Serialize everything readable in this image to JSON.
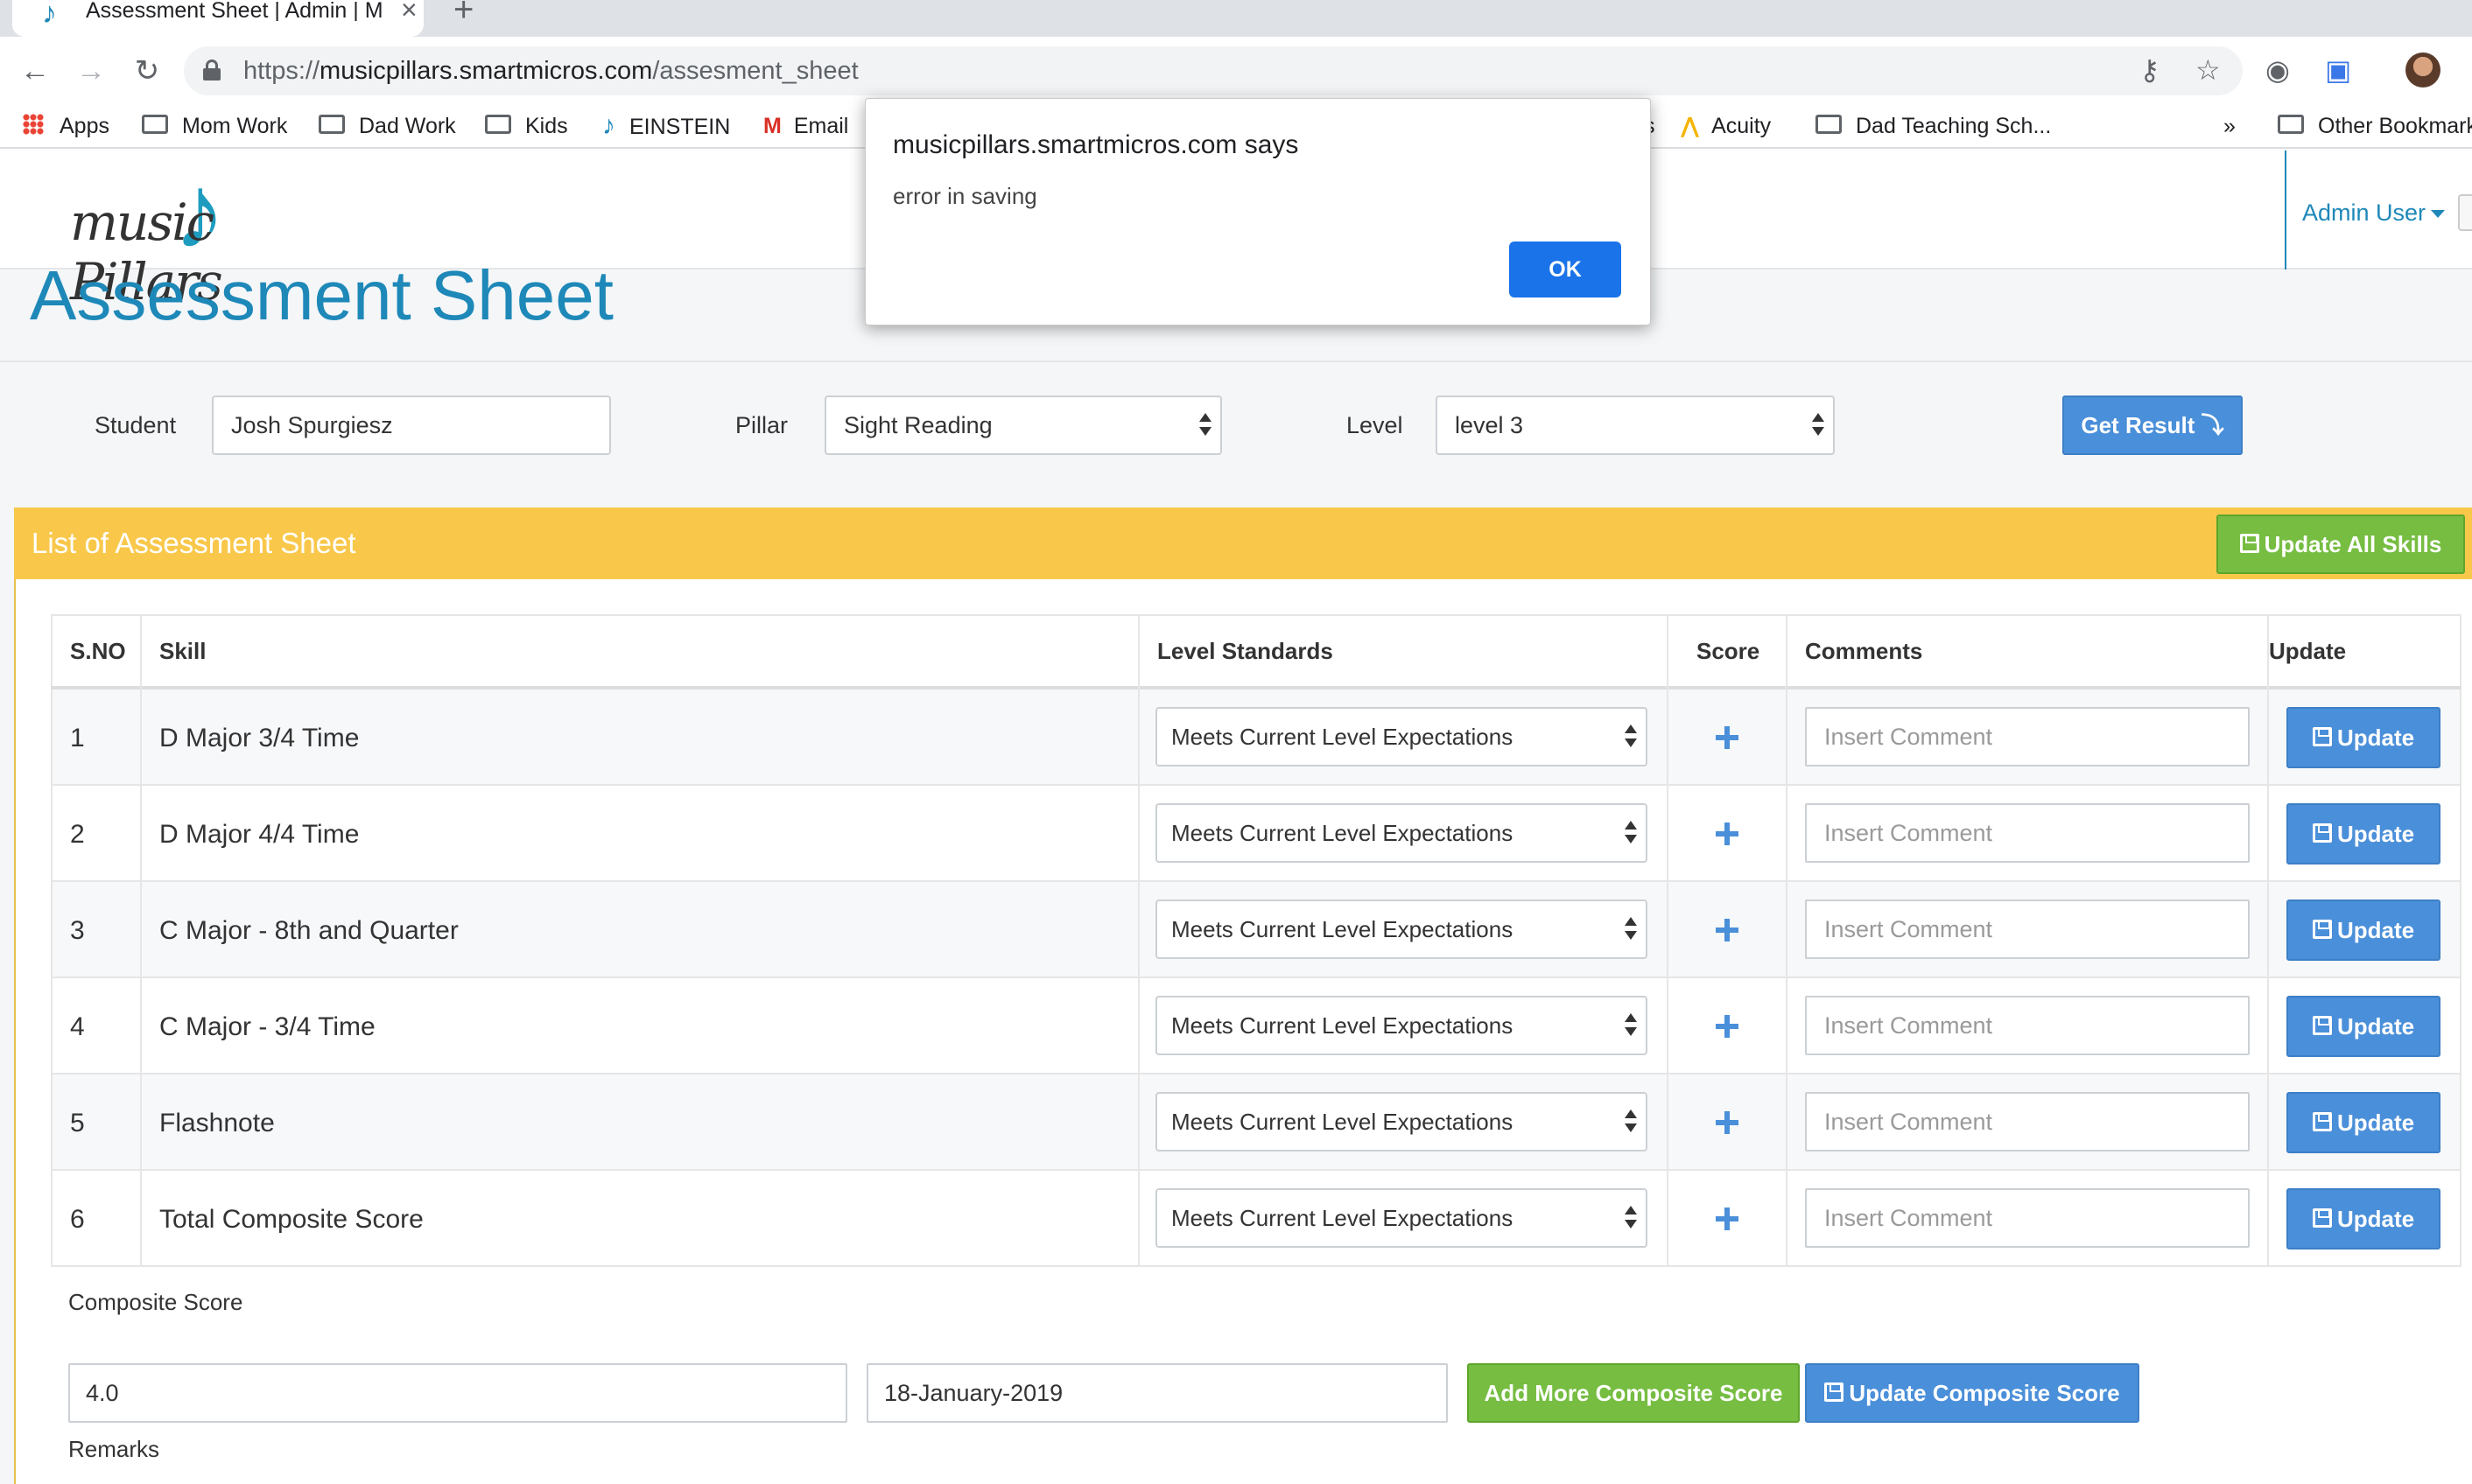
{
  "browser": {
    "tab_title": "Assessment Sheet | Admin | Mu",
    "tab_close": "×",
    "new_tab": "+",
    "url_scheme": "https://",
    "url_host": "musicpillars.smartmicros.com",
    "url_path": "/assesment_sheet",
    "bookmarks": [
      {
        "label": "Apps"
      },
      {
        "label": "Mom Work"
      },
      {
        "label": "Dad Work"
      },
      {
        "label": "Kids"
      },
      {
        "label": "EINSTEIN"
      },
      {
        "label": "Email"
      },
      {
        "label": "s"
      },
      {
        "label": "Acuity"
      },
      {
        "label": "Dad Teaching Sch..."
      },
      {
        "label": "»"
      },
      {
        "label": "Other Bookmarks"
      }
    ]
  },
  "header": {
    "logo_text": "music Pillars",
    "admin_user": "Admin User"
  },
  "page": {
    "title": "Assessment Sheet"
  },
  "filters": {
    "student_label": "Student",
    "student_value": "Josh Spurgiesz",
    "pillar_label": "Pillar",
    "pillar_value": "Sight Reading",
    "level_label": "Level",
    "level_value": "level 3",
    "get_result": "Get Result ⤵"
  },
  "panel": {
    "title": "List of Assessment Sheet",
    "update_all": "Update All Skills"
  },
  "table": {
    "headers": {
      "sno": "S.NO",
      "skill": "Skill",
      "level_standards": "Level Standards",
      "score": "Score",
      "comments": "Comments",
      "update": "Update"
    },
    "rows": [
      {
        "sno": "1",
        "skill": "D Major 3/4 Time",
        "standard": "Meets Current Level Expectations",
        "comment_placeholder": "Insert Comment",
        "update": "Update"
      },
      {
        "sno": "2",
        "skill": "D Major 4/4 Time",
        "standard": "Meets Current Level Expectations",
        "comment_placeholder": "Insert Comment",
        "update": "Update"
      },
      {
        "sno": "3",
        "skill": "C Major - 8th and Quarter",
        "standard": "Meets Current Level Expectations",
        "comment_placeholder": "Insert Comment",
        "update": "Update"
      },
      {
        "sno": "4",
        "skill": "C Major - 3/4 Time",
        "standard": "Meets Current Level Expectations",
        "comment_placeholder": "Insert Comment",
        "update": "Update"
      },
      {
        "sno": "5",
        "skill": "Flashnote",
        "standard": "Meets Current Level Expectations",
        "comment_placeholder": "Insert Comment",
        "update": "Update"
      },
      {
        "sno": "6",
        "skill": "Total Composite Score",
        "standard": "Meets Current Level Expectations",
        "comment_placeholder": "Insert Comment",
        "update": "Update"
      }
    ]
  },
  "composite": {
    "label": "Composite Score",
    "score": "4.0",
    "date": "18-January-2019",
    "add_more": "Add More Composite Score",
    "update": "Update Composite Score",
    "remarks_label": "Remarks"
  },
  "dialog": {
    "title": "musicpillars.smartmicros.com says",
    "message": "error in saving",
    "ok": "OK"
  },
  "colors": {
    "brand": "#1e88b8",
    "panel_header": "#f9c84b",
    "primary_button": "#4a8fd9",
    "success_button": "#76bd42",
    "dialog_ok": "#1a73e8"
  }
}
